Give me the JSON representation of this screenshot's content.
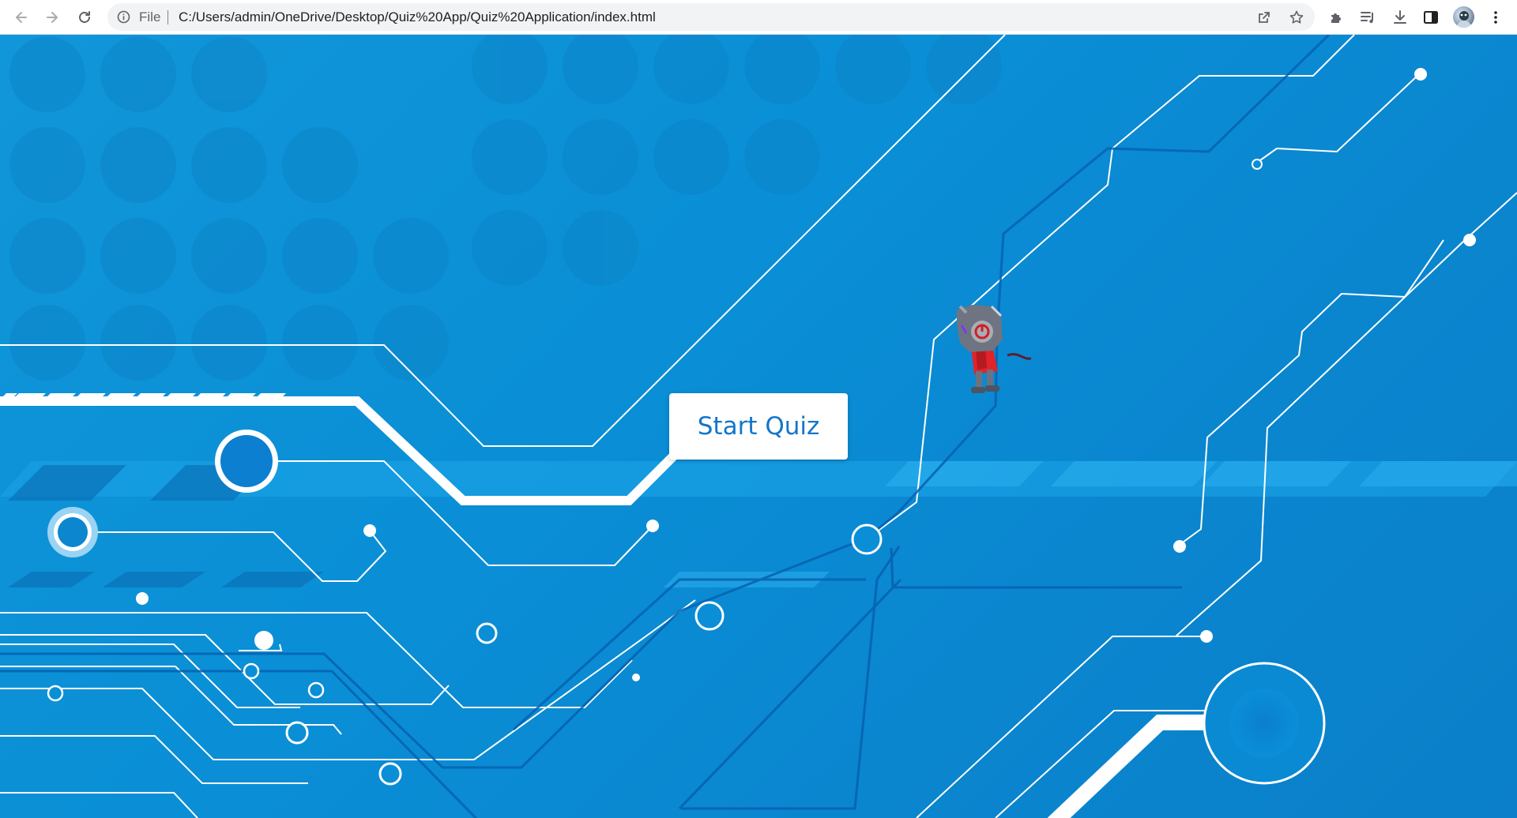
{
  "browser": {
    "scheme_label": "File",
    "url": "C:/Users/admin/OneDrive/Desktop/Quiz%20App/Quiz%20Application/index.html",
    "icons": {
      "back": "arrow-left-icon",
      "forward": "arrow-right-icon",
      "reload": "reload-icon",
      "site_info": "info-icon",
      "share": "share-icon",
      "bookmark": "star-icon",
      "extensions": "puzzle-icon",
      "media": "playlist-icon",
      "downloads": "download-icon",
      "side_panel": "side-panel-icon",
      "profile": "avatar",
      "menu": "kebab-menu-icon"
    }
  },
  "page": {
    "start_button_label": "Start Quiz",
    "colors": {
      "background": "#0a8fd6",
      "circuit_lines": "#ffffff",
      "button_text": "#1476c9"
    },
    "character": "robot-cat-character"
  }
}
